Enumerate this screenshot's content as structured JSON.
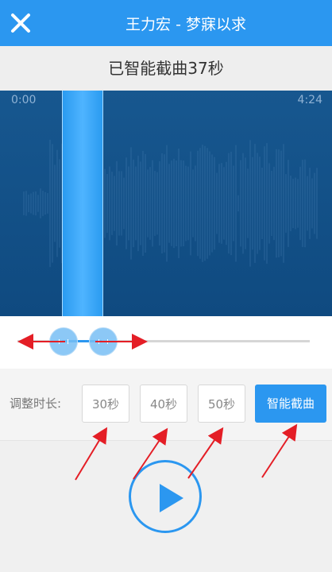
{
  "header": {
    "title": "王力宏 - 梦寐以求",
    "close_icon": "close-icon"
  },
  "status": {
    "text": "已智能截曲37秒"
  },
  "waveform": {
    "start_time": "0:00",
    "end_time": "4:24"
  },
  "duration": {
    "label": "调整时长:",
    "options": [
      "30秒",
      "40秒",
      "50秒"
    ],
    "smart_label": "智能截曲"
  },
  "player": {
    "play_icon": "play-icon"
  },
  "colors": {
    "accent": "#2b97f0",
    "wave_bg": "#0f4a80",
    "annotation": "#e41e26"
  }
}
